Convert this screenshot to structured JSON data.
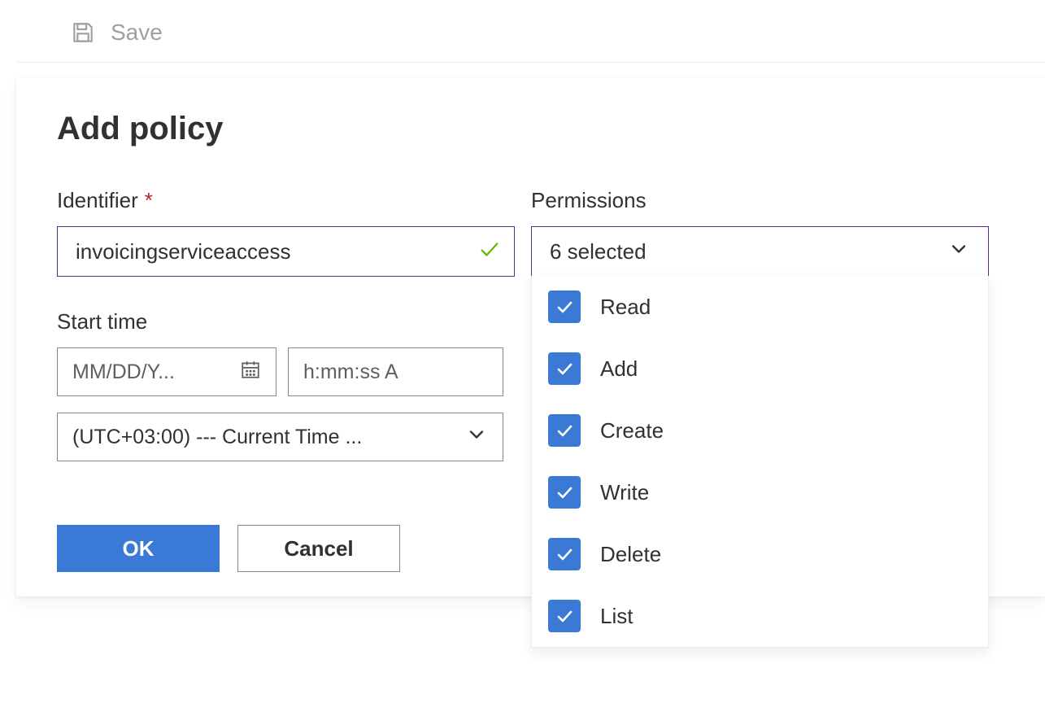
{
  "toolbar": {
    "save_label": "Save"
  },
  "panel": {
    "title": "Add policy",
    "identifier_label": "Identifier",
    "identifier_value": "invoicingserviceaccess",
    "start_time_label": "Start time",
    "date_placeholder": "MM/DD/Y...",
    "time_placeholder": "h:mm:ss A",
    "timezone_display": "(UTC+03:00) --- Current Time ...",
    "ok_label": "OK",
    "cancel_label": "Cancel"
  },
  "permissions": {
    "label": "Permissions",
    "summary": "6 selected",
    "options": [
      {
        "label": "Read",
        "checked": true
      },
      {
        "label": "Add",
        "checked": true
      },
      {
        "label": "Create",
        "checked": true
      },
      {
        "label": "Write",
        "checked": true
      },
      {
        "label": "Delete",
        "checked": true
      },
      {
        "label": "List",
        "checked": true
      }
    ]
  },
  "background": {
    "add_policy_label": "Add policy"
  },
  "colors": {
    "accent_blue": "#3a7ad6",
    "accent_purple_border": "#5c2d91",
    "valid_green": "#6bb700"
  }
}
